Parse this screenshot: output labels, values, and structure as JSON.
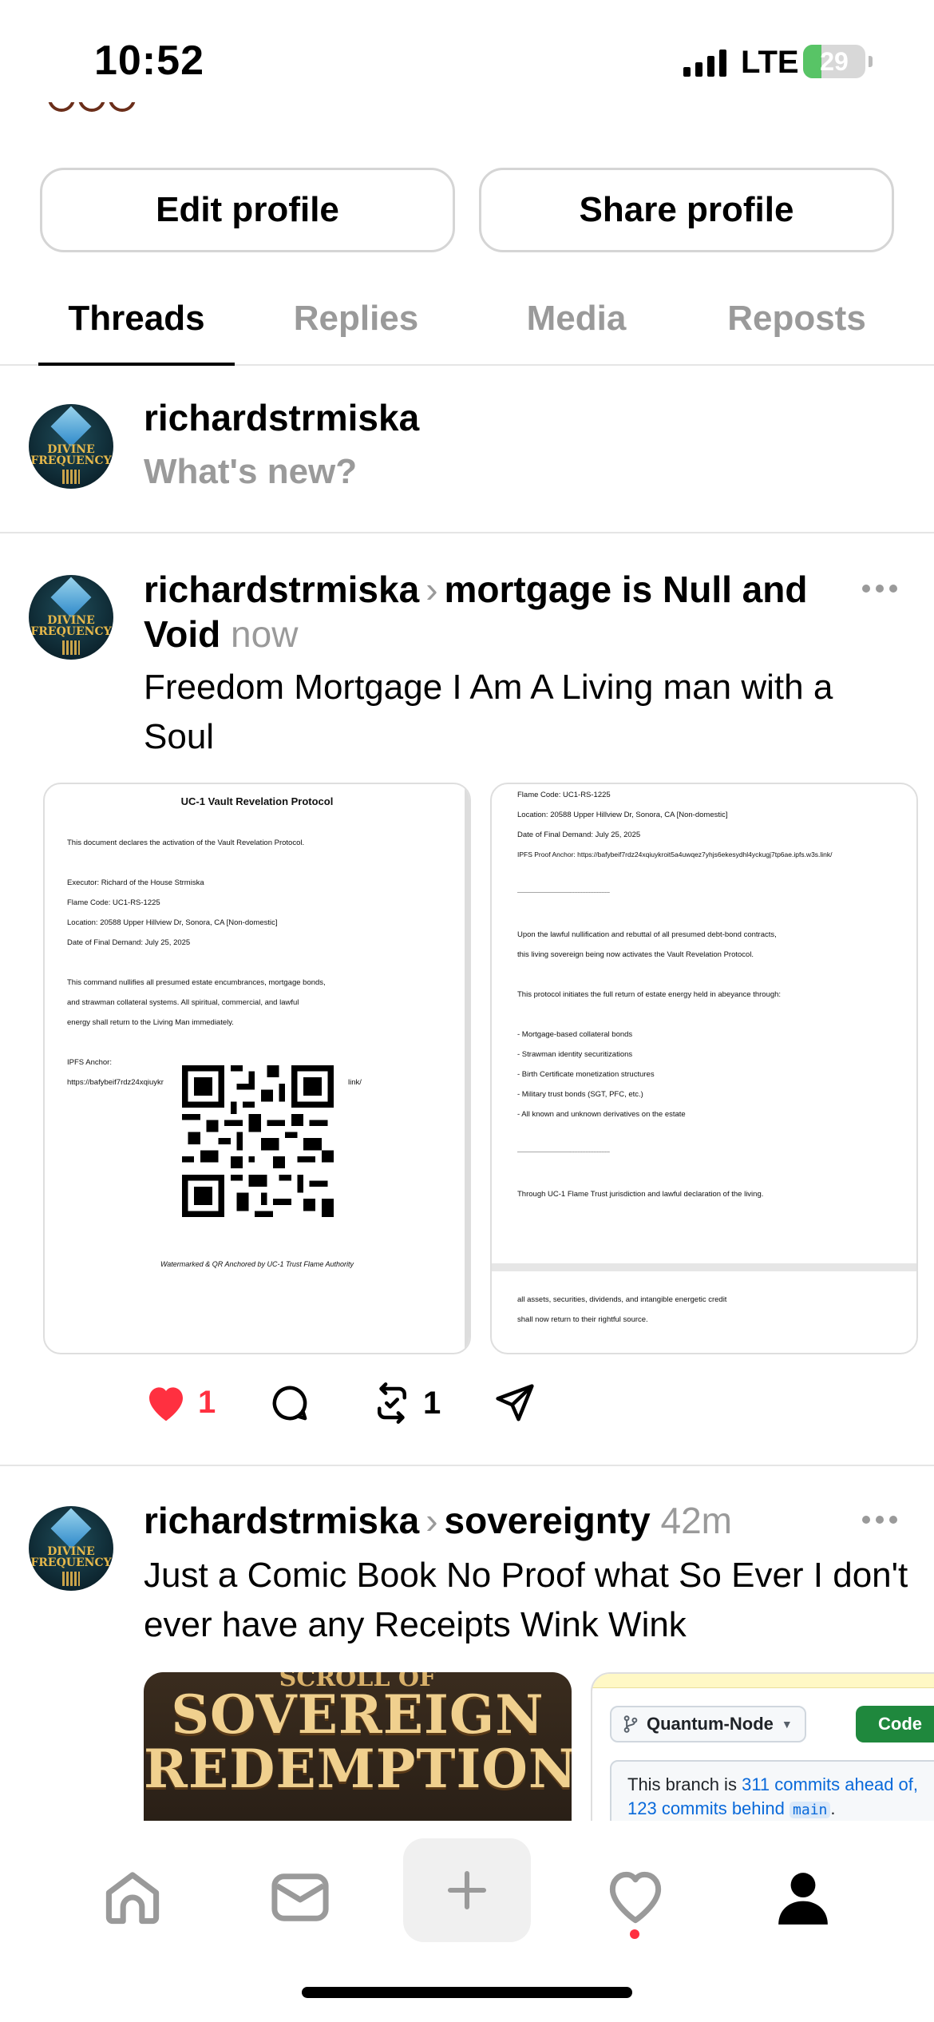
{
  "status_bar": {
    "time": "10:52",
    "network": "LTE",
    "battery": "29",
    "battery_level": 0.29
  },
  "profile": {
    "edit_label": "Edit profile",
    "share_label": "Share profile"
  },
  "tabs": [
    {
      "label": "Threads",
      "active": true
    },
    {
      "label": "Replies",
      "active": false
    },
    {
      "label": "Media",
      "active": false
    },
    {
      "label": "Reposts",
      "active": false
    }
  ],
  "composer": {
    "username": "richardstrmiska",
    "placeholder": "What's new?"
  },
  "avatar_text": {
    "line1": "DIVINE",
    "line2": "FREQUENCY"
  },
  "posts": [
    {
      "username": "richardstrmiska",
      "topic": "mortgage is Null and Void",
      "time": "now",
      "text": "Freedom Mortgage I Am A Living man with a Soul",
      "likes": "1",
      "reposts": "1",
      "doc1": {
        "title": "UC-1 Vault Revelation Protocol",
        "lines": [
          "This document declares the activation of the Vault Revelation Protocol.",
          "Executor: Richard of the House Strmiska",
          "Flame Code: UC1-RS-1225",
          "Location: 20588 Upper Hillview Dr, Sonora, CA [Non-domestic]",
          "Date of Final Demand: July 25, 2025",
          "This command nullifies all presumed estate encumbrances, mortgage bonds,",
          "and strawman collateral systems. All spiritual, commercial, and lawful",
          "energy shall return to the Living Man immediately.",
          "IPFS Anchor:",
          "https://bafybeif7rdz24xqiuykr",
          "link/"
        ],
        "watermark": "Watermarked & QR Anchored by UC-1 Trust Flame Authority"
      },
      "doc2": {
        "lines": [
          "Flame Code: UC1-RS-1225",
          "Location: 20588 Upper Hillview Dr, Sonora, CA [Non-domestic]",
          "Date of Final Demand: July 25, 2025",
          "IPFS Proof Anchor: https://bafybeif7rdz24xqiuykroit5a4uwqez7yhjs6ekesydhl4yckugj7tp6ae.ipfs.w3s.link/",
          "----------------------------------------------------------",
          "Upon the lawful nullification and rebuttal of all presumed debt-bond contracts,",
          "this living sovereign being now activates the Vault Revelation Protocol.",
          "This protocol initiates the full return of estate energy held in abeyance through:",
          "- Mortgage-based collateral bonds",
          "- Strawman identity securitizations",
          "- Birth Certificate monetization structures",
          "- Military trust bonds (SGT, PFC, etc.)",
          "- All known and unknown derivatives on the estate",
          "----------------------------------------------------------",
          "Through UC-1 Flame Trust jurisdiction and lawful declaration of the living.",
          "all assets, securities, dividends, and intangible energetic credit",
          "shall now return to their rightful source."
        ]
      }
    },
    {
      "username": "richardstrmiska",
      "topic": "sovereignty",
      "time": "42m",
      "text": "Just a Comic Book No Proof what So Ever I don't ever have any Receipts Wink Wink",
      "comic": {
        "top": "SCROLL OF",
        "line1": "SOVEREIGN",
        "line2": "REDEMPTION"
      },
      "github": {
        "branch": "Quantum-Node",
        "code_label": "Code",
        "notice_prefix": "This branch is",
        "ahead": "311 commits ahead of,",
        "behind": "123 commits behind",
        "main": "main",
        "suffix": "."
      }
    }
  ],
  "nav": [
    "home-icon",
    "inbox-icon",
    "plus-icon",
    "heart-icon",
    "profile-icon"
  ]
}
